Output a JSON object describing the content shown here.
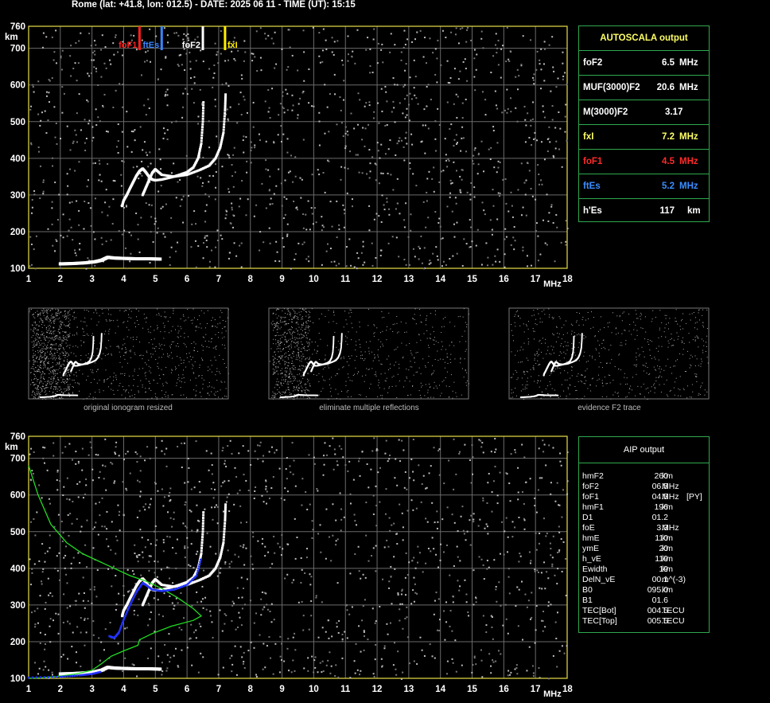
{
  "header": {
    "title": "Rome (lat: +41.8, lon: 012.5) - DATE: 2025 06 11 - TIME (UT): 15:15"
  },
  "colors": {
    "grid": "#6a6a6a",
    "frame": "#e8e046",
    "panel_border": "#2fa84f",
    "foF1": "#ff2020",
    "ftEs": "#3a86ff",
    "foF2": "#ffffff",
    "fxI": "#ffee00",
    "profile": "#22dd22",
    "fit": "#2233ff"
  },
  "autoscala": {
    "title": "AUTOSCALA output",
    "rows": [
      {
        "label": "foF2",
        "value": "6.5",
        "unit": "MHz",
        "color": "#ffffff"
      },
      {
        "label": "MUF(3000)F2",
        "value": "20.6",
        "unit": "MHz",
        "color": "#ffffff"
      },
      {
        "label": "M(3000)F2",
        "value": "3.17",
        "unit": "",
        "color": "#ffffff"
      },
      {
        "label": "fxI",
        "value": "7.2",
        "unit": "MHz",
        "color": "#ffff66"
      },
      {
        "label": "foF1",
        "value": "4.5",
        "unit": "MHz",
        "color": "#ff2a2a"
      },
      {
        "label": "ftEs",
        "value": "5.2",
        "unit": "MHz",
        "color": "#3a8dff"
      },
      {
        "label": "h'Es",
        "value": "117",
        "unit": "km",
        "color": "#ffffff"
      }
    ]
  },
  "aip": {
    "title": "AIP output",
    "rows": [
      {
        "k": "hmF2",
        "v": "260",
        "u": "km",
        "x": ""
      },
      {
        "k": "foF2",
        "v": "06.5",
        "u": "MHz",
        "x": ""
      },
      {
        "k": "foF1",
        "v": "04.5",
        "u": "MHz",
        "x": "[PY]"
      },
      {
        "k": "hmF1",
        "v": "196",
        "u": "km",
        "x": ""
      },
      {
        "k": "D1",
        "v": "01.2",
        "u": "",
        "x": ""
      },
      {
        "k": "foE",
        "v": "3.3",
        "u": "MHz",
        "x": ""
      },
      {
        "k": "hmE",
        "v": "110",
        "u": "km",
        "x": ""
      },
      {
        "k": "ymE",
        "v": "20",
        "u": "km",
        "x": ""
      },
      {
        "k": "h_vE",
        "v": "119",
        "u": "km",
        "x": ""
      },
      {
        "k": "Ewidth",
        "v": "19",
        "u": "km",
        "x": ""
      },
      {
        "k": "DelN_vE",
        "v": "00.1",
        "u": "m^(-3)",
        "x": ""
      },
      {
        "k": "B0",
        "v": "095.0",
        "u": "km",
        "x": ""
      },
      {
        "k": "B1",
        "v": "01.6",
        "u": "",
        "x": ""
      },
      {
        "k": "TEC[Bot]",
        "v": "004.5",
        "u": "TECU",
        "x": ""
      },
      {
        "k": "TEC[Top]",
        "v": "005.5",
        "u": "TECU",
        "x": ""
      }
    ]
  },
  "captions": {
    "thumb1": "original ionogram resized",
    "thumb2": "eliminate multiple reflections",
    "thumb3": "evidence F2 trace"
  },
  "chart_data": [
    {
      "type": "scatter",
      "title": "",
      "xlabel": "MHz",
      "ylabel": "km",
      "xlim": [
        1,
        18
      ],
      "ylim": [
        100,
        760
      ],
      "x_ticks": [
        1,
        2,
        3,
        4,
        5,
        6,
        7,
        8,
        9,
        10,
        11,
        12,
        13,
        14,
        15,
        16,
        17,
        18
      ],
      "y_ticks": [
        100,
        200,
        300,
        400,
        500,
        600,
        700,
        760
      ],
      "markers": [
        {
          "name": "foF1",
          "x": 4.5
        },
        {
          "name": "ftEs",
          "x": 5.2
        },
        {
          "name": "foF2",
          "x": 6.5
        },
        {
          "name": "fxI",
          "x": 7.2
        }
      ],
      "series": [
        {
          "name": "F trace (o)",
          "points": [
            [
              3.95,
              270
            ],
            [
              4.0,
              285
            ],
            [
              4.1,
              300
            ],
            [
              4.2,
              318
            ],
            [
              4.3,
              335
            ],
            [
              4.4,
              352
            ],
            [
              4.5,
              365
            ],
            [
              4.6,
              372
            ],
            [
              4.7,
              362
            ],
            [
              4.8,
              350
            ],
            [
              4.9,
              342
            ],
            [
              5.0,
              340
            ],
            [
              5.2,
              342
            ],
            [
              5.5,
              348
            ],
            [
              5.8,
              356
            ],
            [
              6.0,
              362
            ],
            [
              6.2,
              375
            ],
            [
              6.35,
              400
            ],
            [
              6.45,
              440
            ],
            [
              6.5,
              500
            ],
            [
              6.52,
              560
            ]
          ]
        },
        {
          "name": "F trace (x)",
          "points": [
            [
              4.6,
              300
            ],
            [
              4.7,
              320
            ],
            [
              4.8,
              340
            ],
            [
              4.9,
              360
            ],
            [
              5.0,
              370
            ],
            [
              5.2,
              355
            ],
            [
              5.6,
              350
            ],
            [
              6.0,
              355
            ],
            [
              6.4,
              368
            ],
            [
              6.7,
              380
            ],
            [
              6.9,
              400
            ],
            [
              7.05,
              430
            ],
            [
              7.15,
              470
            ],
            [
              7.2,
              530
            ],
            [
              7.22,
              580
            ]
          ]
        },
        {
          "name": "E/Es trace",
          "points": [
            [
              2.0,
              112
            ],
            [
              2.4,
              113
            ],
            [
              2.8,
              115
            ],
            [
              3.1,
              118
            ],
            [
              3.3,
              122
            ],
            [
              3.5,
              130
            ],
            [
              3.7,
              128
            ],
            [
              4.0,
              127
            ],
            [
              4.4,
              126
            ],
            [
              4.8,
              126
            ],
            [
              5.2,
              125
            ]
          ]
        }
      ]
    },
    {
      "type": "line",
      "title": "",
      "xlabel": "MHz",
      "ylabel": "km",
      "xlim": [
        1,
        18
      ],
      "ylim": [
        100,
        760
      ],
      "x_ticks": [
        1,
        2,
        3,
        4,
        5,
        6,
        7,
        8,
        9,
        10,
        11,
        12,
        13,
        14,
        15,
        16,
        17,
        18
      ],
      "y_ticks": [
        100,
        200,
        300,
        400,
        500,
        600,
        700,
        760
      ],
      "series": [
        {
          "name": "electron density profile",
          "points": [
            [
              1.0,
              680
            ],
            [
              1.3,
              600
            ],
            [
              1.7,
              520
            ],
            [
              2.2,
              470
            ],
            [
              2.7,
              440
            ],
            [
              3.2,
              420
            ],
            [
              3.7,
              400
            ],
            [
              4.2,
              380
            ],
            [
              4.7,
              365
            ],
            [
              5.2,
              345
            ],
            [
              5.7,
              320
            ],
            [
              6.2,
              290
            ],
            [
              6.45,
              270
            ],
            [
              6.2,
              258
            ],
            [
              5.5,
              242
            ],
            [
              4.9,
              222
            ],
            [
              4.5,
              205
            ],
            [
              4.45,
              190
            ],
            [
              4.0,
              175
            ],
            [
              3.6,
              160
            ],
            [
              3.3,
              140
            ],
            [
              3.0,
              122
            ],
            [
              2.5,
              112
            ],
            [
              2.0,
              106
            ],
            [
              1.5,
              102
            ],
            [
              1.0,
              100
            ]
          ]
        },
        {
          "name": "synthesized trace",
          "points": [
            [
              3.55,
              215
            ],
            [
              3.7,
              210
            ],
            [
              3.85,
              225
            ],
            [
              4.0,
              260
            ],
            [
              4.2,
              300
            ],
            [
              4.4,
              335
            ],
            [
              4.6,
              360
            ],
            [
              4.7,
              355
            ],
            [
              4.9,
              342
            ],
            [
              5.2,
              338
            ],
            [
              5.6,
              342
            ],
            [
              6.0,
              355
            ],
            [
              6.3,
              380
            ],
            [
              6.45,
              430
            ]
          ]
        },
        {
          "name": "E region fit",
          "points": [
            [
              1.0,
              102
            ],
            [
              2.0,
              104
            ],
            [
              2.6,
              108
            ],
            [
              3.0,
              112
            ],
            [
              3.3,
              118
            ]
          ]
        }
      ]
    }
  ]
}
